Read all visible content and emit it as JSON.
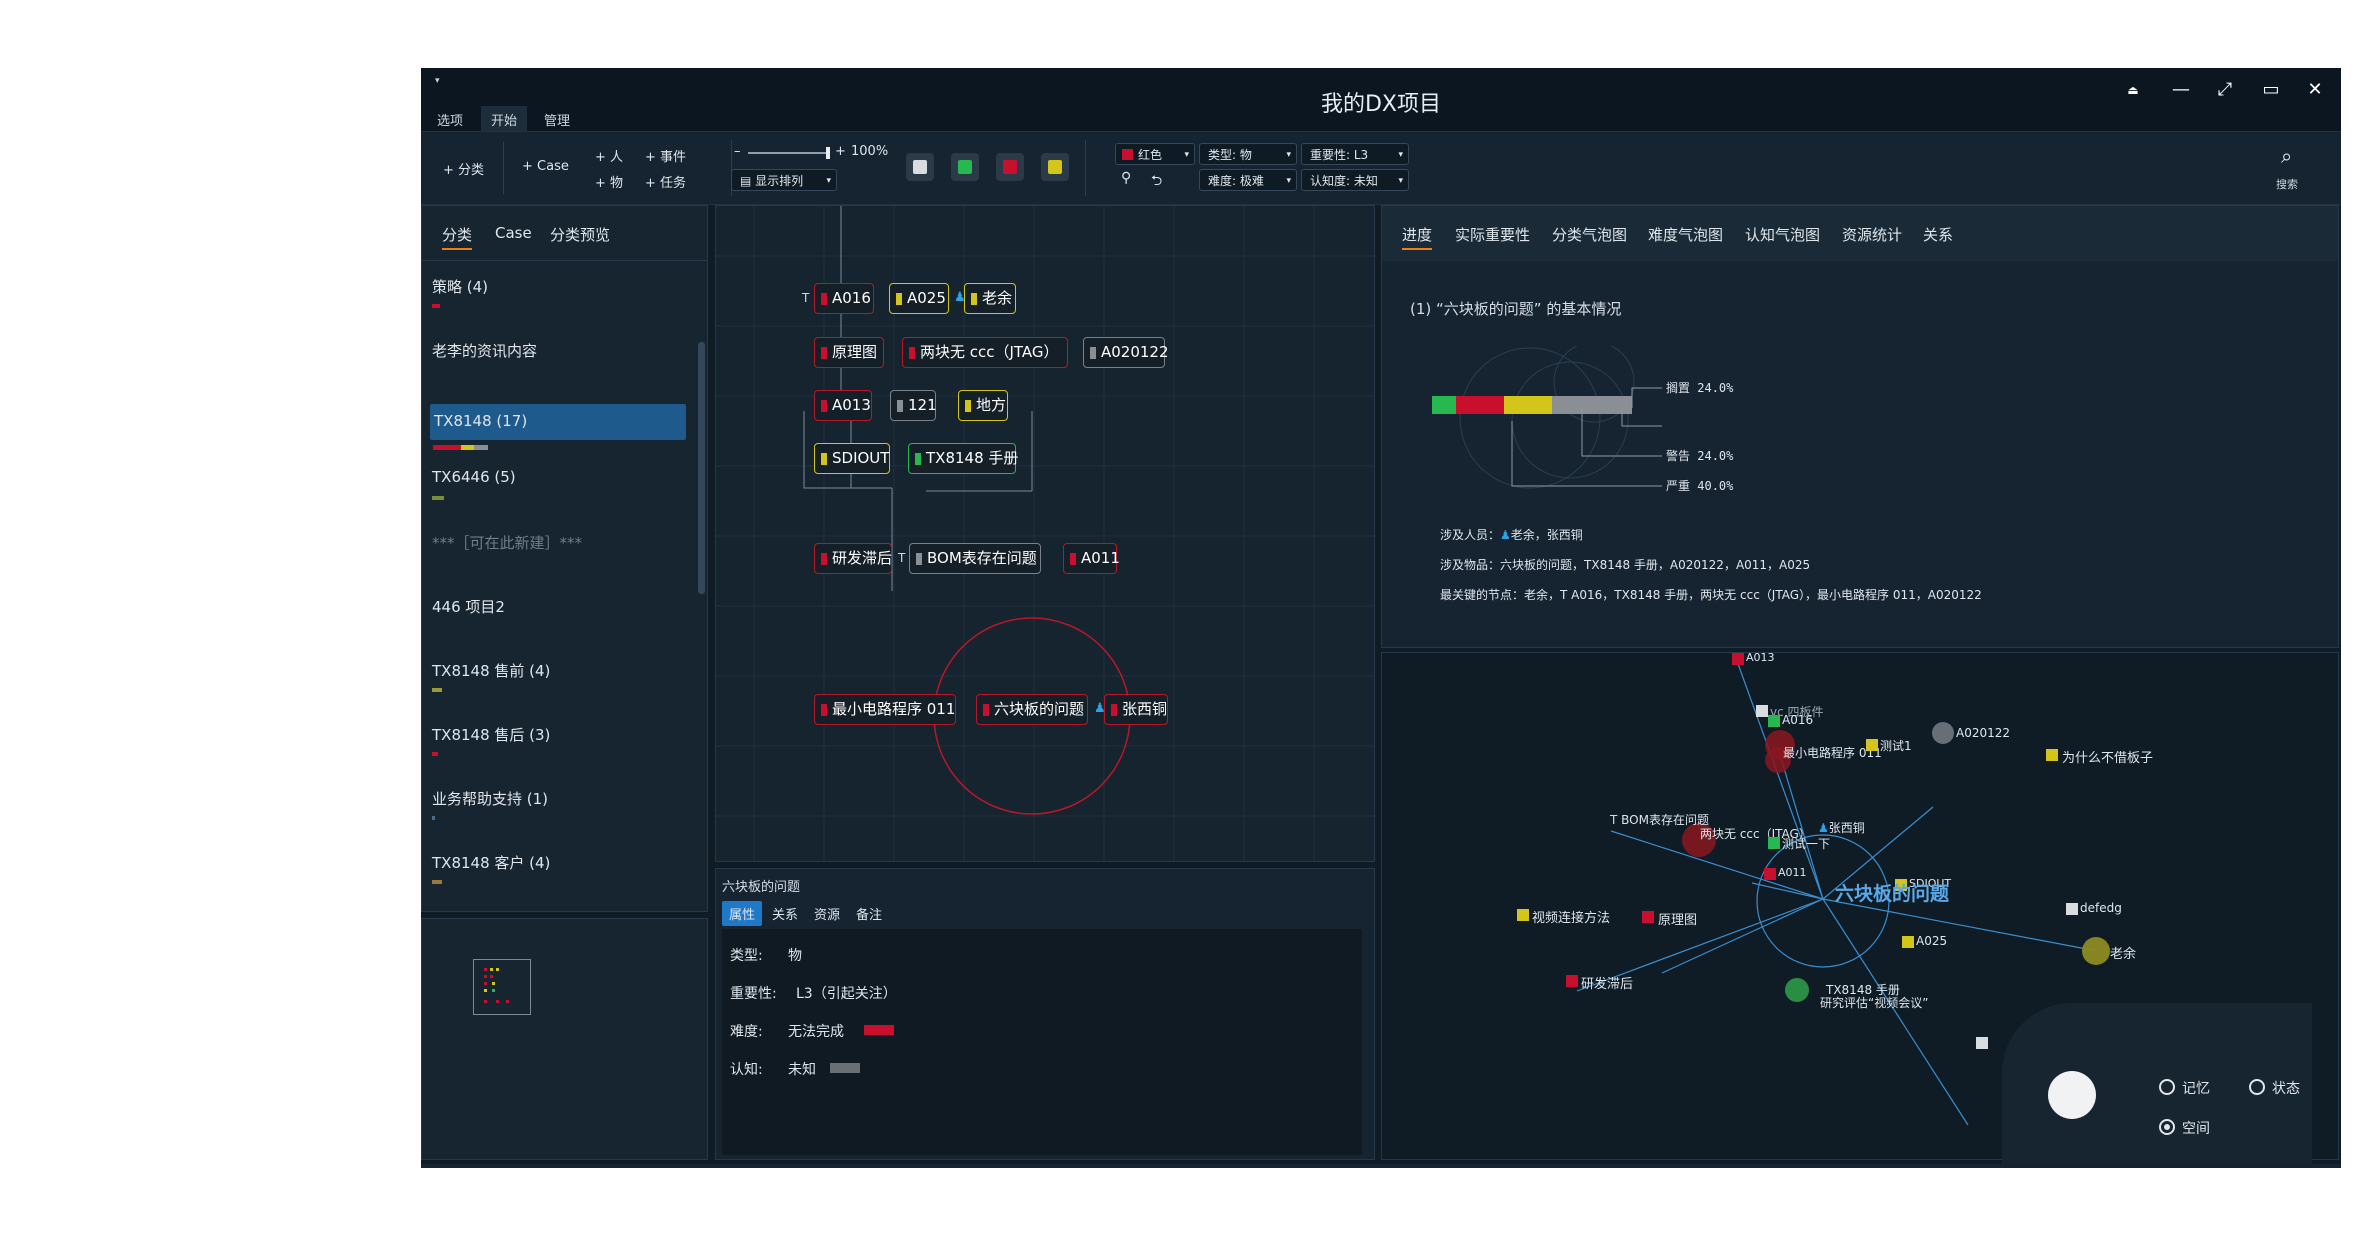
{
  "window": {
    "title": "我的DX项目",
    "menu_tabs": [
      "选项",
      "开始",
      "管理"
    ]
  },
  "ribbon": {
    "add_category": "+ 分类",
    "add_case": "+ Case",
    "add_person": "+ 人",
    "add_object": "+ 物",
    "add_event": "+ 事件",
    "add_task": "+ 任务",
    "zoom": "100%",
    "display_sort": "显示排列",
    "color": "红色",
    "type": "类型: 物",
    "importance": "重要性: L3",
    "difficulty": "难度: 极难",
    "cognition": "认知度: 未知",
    "search": "搜索",
    "swatch_colors": [
      "#d9dde0",
      "#28b850",
      "#c8102e",
      "#d4c51a"
    ]
  },
  "left_panel": {
    "tabs": [
      "分类",
      "Case",
      "分类预览"
    ],
    "items": [
      {
        "label": "策略 (4)"
      },
      {
        "label": "老李的资讯内容"
      },
      {
        "label": "TX8148 (17)"
      },
      {
        "label": "TX6446 (5)"
      },
      {
        "label": "***［可在此新建］***"
      },
      {
        "label": "446 项目2"
      },
      {
        "label": "TX8148 售前 (4)"
      },
      {
        "label": "TX8148 售后 (3)"
      },
      {
        "label": "业务帮助支持 (1)"
      },
      {
        "label": "TX8148 客户 (4)"
      }
    ]
  },
  "graph": {
    "nodes": [
      "A016",
      "A025",
      "老余",
      "原理图",
      "两块无 ccc（JTAG）",
      "A020122",
      "A013",
      "121",
      "地方",
      "SDIOUT",
      "TX8148 手册",
      "研发滞后",
      "BOM表存在问题",
      "A011",
      "最小电路程序 011",
      "六块板的问题",
      "张西铜"
    ]
  },
  "detail": {
    "title": "六块板的问题",
    "tabs": [
      "属性",
      "关系",
      "资源",
      "备注"
    ],
    "type_label": "类型:",
    "type_value": "物",
    "importance_label": "重要性:",
    "importance_value": "L3（引起关注）",
    "difficulty_label": "难度:",
    "difficulty_value": "无法完成",
    "cognition_label": "认知:",
    "cognition_value": "未知"
  },
  "right_panel": {
    "tabs": [
      "进度",
      "实际重要性",
      "分类气泡图",
      "难度气泡图",
      "认知气泡图",
      "资源统计",
      "关系"
    ],
    "heading": "(1) “六块板的问题” 的基本情况",
    "chart_data": {
      "type": "bar",
      "categories": [
        "搁置",
        "警告",
        "严重"
      ],
      "values": [
        24.0,
        24.0,
        40.0
      ],
      "value_labels": [
        "24.0%",
        "24.0%",
        "40.0%"
      ],
      "segment_colors": [
        "#28b850",
        "#c8102e",
        "#d4c51a",
        "#8a8f94"
      ]
    },
    "people_label": "涉及人员：",
    "people": "老余，张西铜",
    "objects_label": "涉及物品：",
    "objects": "六块板的问题，TX8148 手册，A020122，A011，A025",
    "key_nodes_label": "最关键的节点：",
    "key_nodes": "老余，T A016，TX8148 手册，两块无 ccc（JTAG），最小电路程序 011，A020122"
  },
  "network": {
    "labels": [
      "A013",
      "vc 四板件",
      "A016",
      "最小电路程序 011",
      "测试1",
      "A020122",
      "为什么不借板子",
      "BOM表存在问题",
      "两块无 ccc（JTAG）",
      "张西铜",
      "测试一下",
      "A011",
      "SDIOUT",
      "六块板的问题",
      "视频连接方法",
      "原理图",
      "defedg",
      "A025",
      "老余",
      "研发滞后",
      "TX8148 手册",
      "研究评估“视频会议”"
    ],
    "radio_memory": "记忆",
    "radio_state": "状态",
    "radio_space": "空间"
  }
}
